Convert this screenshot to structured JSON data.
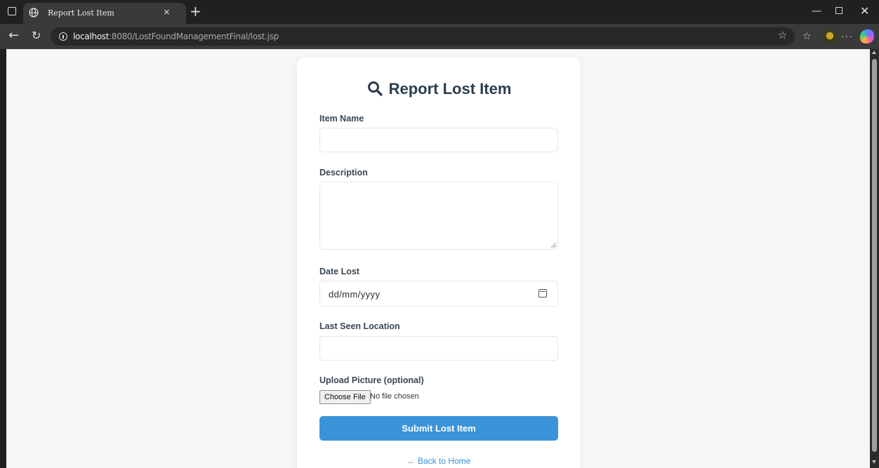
{
  "browser": {
    "tab_title": "Report Lost Item",
    "tab_close": "×",
    "new_tab": "+",
    "url_host": "localhost",
    "url_path": ":8080/LostFoundManagementFinal/lost.jsp",
    "window_controls": {
      "minimize": "—",
      "close": "✕"
    },
    "icons": [
      "window-menu-icon",
      "globe-icon",
      "back-arrow-icon",
      "reload-icon",
      "info-icon",
      "star-icon",
      "favorites-icon",
      "profile-avatar",
      "more-icon",
      "copilot-icon"
    ]
  },
  "form": {
    "title": "Report Lost Item",
    "title_icon": "search-icon",
    "item_name_label": "Item Name",
    "item_name_value": "",
    "description_label": "Description",
    "description_value": "",
    "date_label": "Date Lost",
    "date_placeholder": "dd/mm/yyyy",
    "location_label": "Last Seen Location",
    "location_value": "",
    "upload_label": "Upload Picture (optional)",
    "choose_file_label": "Choose File",
    "file_status": "No file chosen",
    "submit_label": "Submit Lost Item",
    "back_link": "← Back to Home"
  },
  "colors": {
    "accent": "#3b94d9",
    "title_text": "#2c3e50",
    "page_background": "#f4f6f8",
    "link": "#3b8fd6"
  }
}
